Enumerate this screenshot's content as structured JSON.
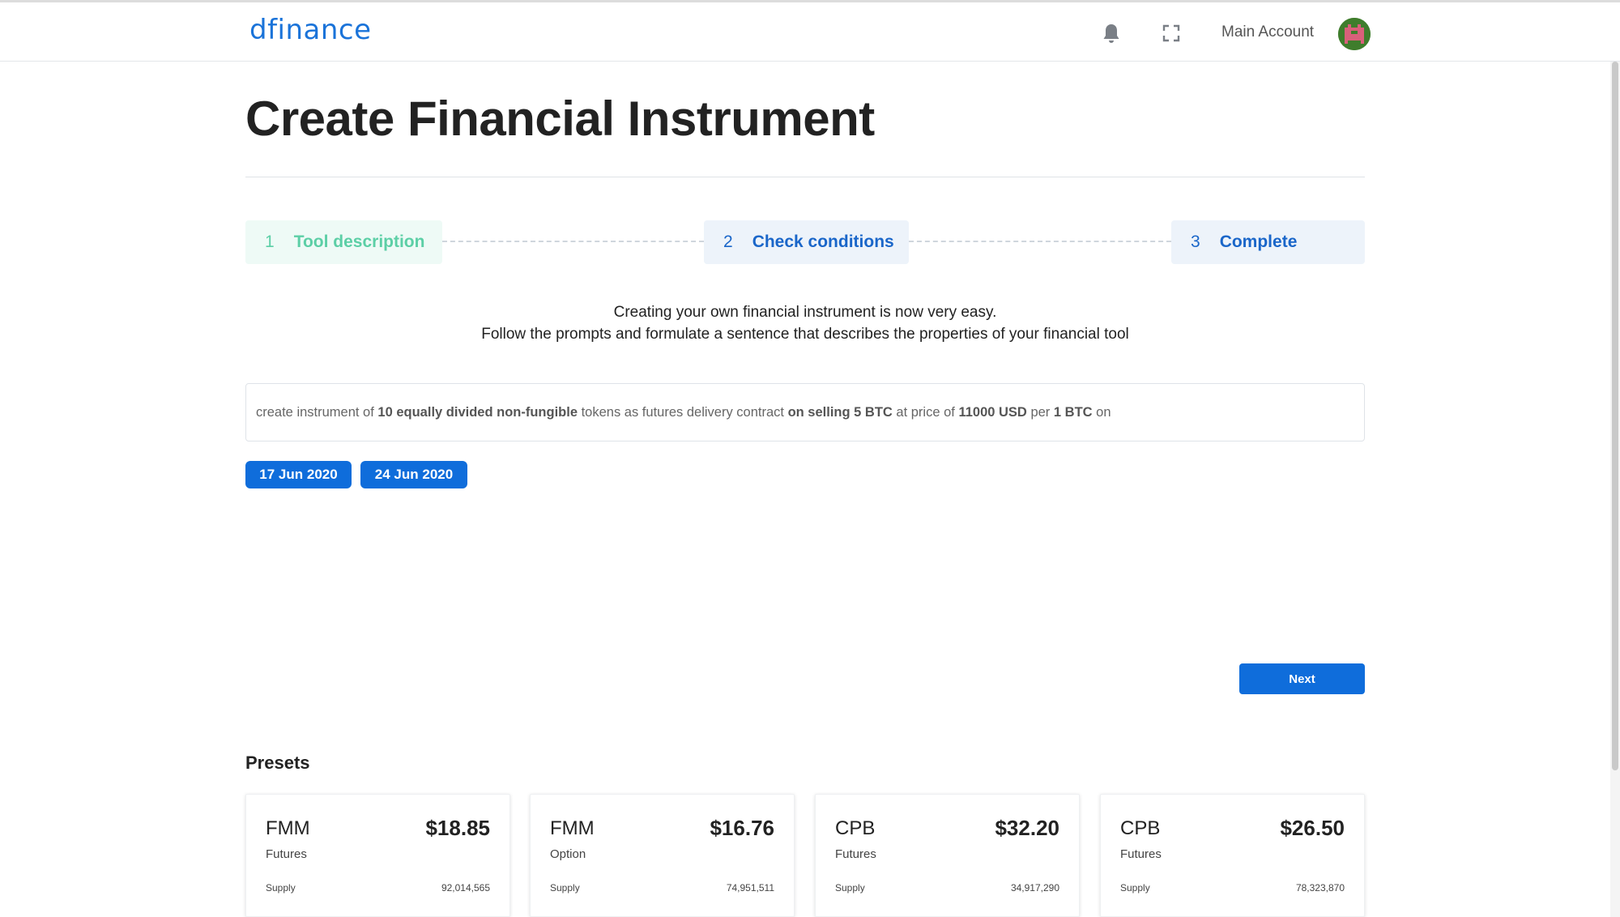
{
  "header": {
    "logo": "dfinance",
    "account_label": "Main Account"
  },
  "page": {
    "title": "Create Financial Instrument"
  },
  "steps": [
    {
      "number": "1",
      "label": "Tool description",
      "state": "completed"
    },
    {
      "number": "2",
      "label": "Check conditions",
      "state": "active"
    },
    {
      "number": "3",
      "label": "Complete",
      "state": "pending"
    }
  ],
  "intro": {
    "line1": "Creating your own financial instrument is now very easy.",
    "line2": "Follow the prompts and formulate a sentence that describes the properties of your financial tool"
  },
  "sentence": {
    "p1": "create instrument of ",
    "b1": "10 equally divided non-fungible",
    "p2": " tokens as futures delivery contract ",
    "b2": "on selling 5 BTC",
    "p3": " at price of ",
    "b3": "11000 USD",
    "p4": " per ",
    "b4": "1 BTC",
    "p5": " on"
  },
  "dates": [
    "17 Jun 2020",
    "24 Jun 2020"
  ],
  "next_label": "Next",
  "presets": {
    "title": "Presets",
    "supply_label": "Supply",
    "items": [
      {
        "ticker": "FMM",
        "price": "$18.85",
        "kind": "Futures",
        "supply": "92,014,565"
      },
      {
        "ticker": "FMM",
        "price": "$16.76",
        "kind": "Option",
        "supply": "74,951,511"
      },
      {
        "ticker": "CPB",
        "price": "$32.20",
        "kind": "Futures",
        "supply": "34,917,290"
      },
      {
        "ticker": "CPB",
        "price": "$26.50",
        "kind": "Futures",
        "supply": "78,323,870"
      }
    ]
  },
  "colors": {
    "brand": "#1a73d9",
    "primary_button": "#0f6ddb",
    "step_completed": "#5ccfa6",
    "step_active": "#1a66c9"
  },
  "icons": [
    "bell-icon",
    "fullscreen-icon",
    "avatar-icon"
  ]
}
